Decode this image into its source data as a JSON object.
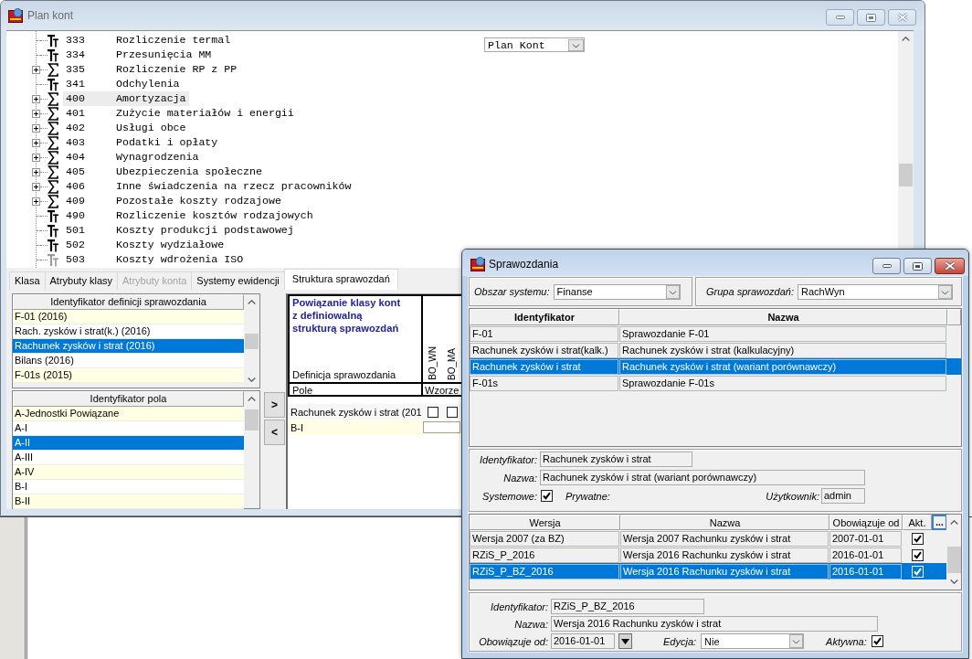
{
  "plan_window": {
    "title": "Plan kont",
    "active": false,
    "tree": [
      {
        "code": "333",
        "name": "Rozliczenie termal",
        "kind": "leaf",
        "selected": false
      },
      {
        "code": "334",
        "name": "Przesunięcia MM",
        "kind": "leaf",
        "selected": false
      },
      {
        "code": "335",
        "name": "Rozliczenie RP z PP",
        "kind": "sum",
        "expanded": false,
        "selected": false
      },
      {
        "code": "341",
        "name": "Odchylenia",
        "kind": "leaf",
        "selected": false
      },
      {
        "code": "400",
        "name": "Amortyzacja",
        "kind": "sum",
        "expanded": false,
        "selected": true
      },
      {
        "code": "401",
        "name": "Zużycie materiałów i energii",
        "kind": "sum",
        "expanded": false,
        "selected": false
      },
      {
        "code": "402",
        "name": "Usługi obce",
        "kind": "sum",
        "expanded": false,
        "selected": false
      },
      {
        "code": "403",
        "name": "Podatki i opłaty",
        "kind": "sum",
        "expanded": false,
        "selected": false
      },
      {
        "code": "404",
        "name": "Wynagrodzenia",
        "kind": "sum",
        "expanded": false,
        "selected": false
      },
      {
        "code": "405",
        "name": "Ubezpieczenia społeczne",
        "kind": "sum",
        "expanded": false,
        "selected": false
      },
      {
        "code": "406",
        "name": "Inne świadczenia na rzecz pracowników",
        "kind": "sum",
        "expanded": false,
        "selected": false
      },
      {
        "code": "409",
        "name": "Pozostałe koszty rodzajowe",
        "kind": "sum",
        "expanded": false,
        "selected": false
      },
      {
        "code": "490",
        "name": "Rozliczenie kosztów rodzajowych",
        "kind": "leaf",
        "selected": false
      },
      {
        "code": "501",
        "name": "Koszty produkcji podstawowej",
        "kind": "leaf",
        "selected": false
      },
      {
        "code": "502",
        "name": "Koszty wydziałowe",
        "kind": "leaf",
        "selected": false
      },
      {
        "code": "503",
        "name": "Koszty wdrożenia ISO",
        "kind": "inactive",
        "selected": false
      }
    ],
    "account_plan_select": {
      "value": "Plan Kont"
    },
    "tabs": [
      {
        "label": "Klasa",
        "selected": false,
        "disabled": false
      },
      {
        "label": "Atrybuty klasy",
        "selected": false,
        "disabled": false
      },
      {
        "label": "Atrybuty konta",
        "selected": false,
        "disabled": true
      },
      {
        "label": "Systemy ewidencji",
        "selected": false,
        "disabled": false
      },
      {
        "label": "Struktura sprawozdań",
        "selected": true,
        "disabled": false
      }
    ],
    "report_definitions": {
      "header": "Identyfikator definicji sprawozdania",
      "rows": [
        {
          "label": "F-01 (2016)",
          "selected": false
        },
        {
          "label": "Rach. zysków i strat(k.) (2016)",
          "selected": false
        },
        {
          "label": "Rachunek zysków i strat (2016)",
          "selected": true
        },
        {
          "label": "Bilans (2016)",
          "selected": false
        },
        {
          "label": "F-01s (2015)",
          "selected": false
        }
      ]
    },
    "report_fields": {
      "header": "Identyfikator pola",
      "rows": [
        {
          "label": "A-Jednostki Powiązane",
          "selected": false
        },
        {
          "label": "A-I",
          "selected": false
        },
        {
          "label": "A-II",
          "selected": true
        },
        {
          "label": "A-III",
          "selected": false
        },
        {
          "label": "A-IV",
          "selected": false
        },
        {
          "label": "B-I",
          "selected": false
        },
        {
          "label": "B-II",
          "selected": false
        }
      ]
    },
    "move_buttons": [
      ">",
      "<"
    ],
    "mapping": {
      "title": "Powiązanie klasy kont\nz definiowalną\nstrukturą sprawozdań",
      "definition_label": "Definicja sprawozdania",
      "field_label": "Pole",
      "columns": [
        "BO_WN",
        "BO_MA"
      ],
      "column_3": "Wzorze",
      "rows": [
        {
          "kind": "checks",
          "label": "Rachunek zysków i strat (201",
          "checks": [
            false,
            false
          ]
        },
        {
          "kind": "input",
          "label": "B-I"
        }
      ]
    }
  },
  "sprawozdania_window": {
    "title": "Sprawozdania",
    "active": true,
    "filters": [
      {
        "label": "Obszar systemu:",
        "value": "Finanse"
      },
      {
        "label": "Grupa sprawozdań:",
        "value": "RachWyn"
      }
    ],
    "reports": {
      "columns": [
        "Identyfikator",
        "Nazwa"
      ],
      "rows": [
        {
          "identifier": "F-01",
          "name": "Sprawozdanie F-01",
          "selected": false
        },
        {
          "identifier": "Rachunek zysków i strat(kalk.)",
          "name": "Rachunek zysków i strat (kalkulacyjny)",
          "selected": false
        },
        {
          "identifier": "Rachunek zysków i strat",
          "name": "Rachunek zysków i strat (wariant porównawczy)",
          "selected": true
        },
        {
          "identifier": "F-01s",
          "name": "Sprawozdanie F-01s",
          "selected": false
        }
      ]
    },
    "report_details": {
      "identifier": {
        "label": "Identyfikator:",
        "value": "Rachunek zysków i strat"
      },
      "name": {
        "label": "Nazwa:",
        "value": "Rachunek zysków i strat (wariant porównawczy)"
      },
      "system": {
        "label": "Systemowe:",
        "checked": true
      },
      "private_label": "Prywatne:",
      "user": {
        "label": "Użytkownik:",
        "value": "admin"
      }
    },
    "versions": {
      "columns": [
        "Wersja",
        "Nazwa",
        "Obowiązuje od",
        "Akt."
      ],
      "more_button": "...",
      "rows": [
        {
          "version": "Wersja 2007 (za BZ)",
          "name": "Wersja 2007 Rachunku zysków i strat",
          "valid_from": "2007-01-01",
          "active": true,
          "selected": false
        },
        {
          "version": "RZiS_P_2016",
          "name": "Wersja 2016 Rachunku zysków i strat",
          "valid_from": "2016-01-01",
          "active": true,
          "selected": false
        },
        {
          "version": "RZiS_P_BZ_2016",
          "name": "Wersja 2016 Rachunku zysków i strat",
          "valid_from": "2016-01-01",
          "active": true,
          "selected": true
        }
      ]
    },
    "version_details": {
      "identifier": {
        "label": "Identyfikator:",
        "value": "RZiS_P_BZ_2016"
      },
      "name": {
        "label": "Nazwa:",
        "value": "Wersja 2016 Rachunku zysków i strat"
      },
      "valid_from": {
        "label": "Obowiązuje od:",
        "value": "2016-01-01"
      },
      "edit": {
        "label": "Edycja:",
        "value": "Nie"
      },
      "active": {
        "label": "Aktywna:",
        "checked": true
      }
    }
  }
}
